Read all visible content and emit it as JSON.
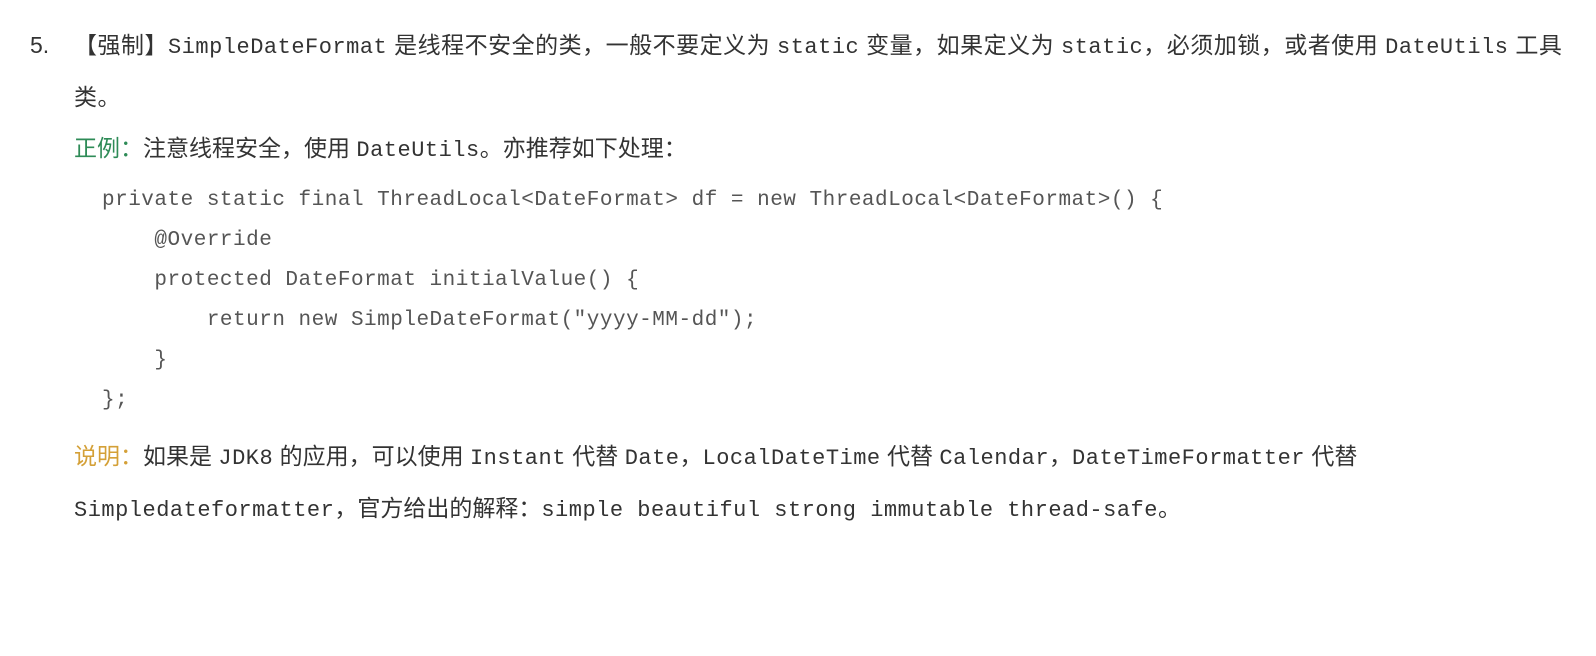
{
  "item": {
    "number": "5.",
    "tag": "【强制】",
    "rule_prefix": "SimpleDateFormat",
    "rule_middle1": " 是线程不安全的类，一般不要定义为 ",
    "rule_static1": "static",
    "rule_middle2": " 变量，如果定义为 ",
    "rule_static2": "static",
    "rule_middle3": "，必须加锁，或者使用 ",
    "rule_dateutils": "DateUtils",
    "rule_end": " 工具类。"
  },
  "example": {
    "label": "正例：",
    "text_prefix": "注意线程安全，使用 ",
    "text_dateutils": "DateUtils",
    "text_suffix": "。亦推荐如下处理："
  },
  "code": {
    "line1": "private static final ThreadLocal<DateFormat> df = new ThreadLocal<DateFormat>() {",
    "line2": "    @Override",
    "line3": "    protected DateFormat initialValue() {",
    "line4": "        return new SimpleDateFormat(\"yyyy-MM-dd\");",
    "line5": "    }",
    "line6": "};"
  },
  "note": {
    "label": "说明：",
    "seg1": "如果是 ",
    "jdk8": "JDK8",
    "seg2": " 的应用，可以使用 ",
    "instant": "Instant",
    "seg3": " 代替 ",
    "date": "Date",
    "seg4": "，",
    "ldt": "LocalDateTime",
    "seg5": " 代替 ",
    "calendar": "Calendar",
    "seg6": "，",
    "dtf": "DateTimeFormatter",
    "seg7": " 代替 ",
    "sdf": "Simpledateformatter",
    "seg8": "，官方给出的解释：",
    "quote": "simple beautiful strong immutable thread-safe",
    "seg9": "。"
  }
}
